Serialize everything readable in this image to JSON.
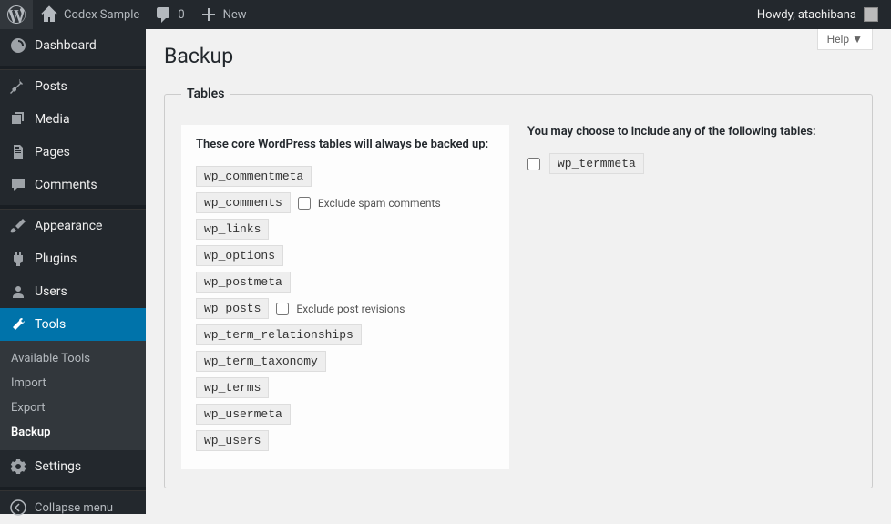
{
  "adminbar": {
    "site_name": "Codex Sample",
    "comments_count": "0",
    "new_label": "New",
    "howdy": "Howdy, atachibana"
  },
  "sidebar": {
    "dashboard": "Dashboard",
    "posts": "Posts",
    "media": "Media",
    "pages": "Pages",
    "comments": "Comments",
    "appearance": "Appearance",
    "plugins": "Plugins",
    "users": "Users",
    "tools": "Tools",
    "settings": "Settings",
    "collapse": "Collapse menu",
    "submenu": {
      "available": "Available Tools",
      "import": "Import",
      "export": "Export",
      "backup": "Backup"
    }
  },
  "page": {
    "help": "Help ▼",
    "title": "Backup",
    "fieldset_legend": "Tables",
    "core_heading": "These core WordPress tables will always be backed up:",
    "opt_heading": "You may choose to include any of the following tables:",
    "exclude_spam": "Exclude spam comments",
    "exclude_revisions": "Exclude post revisions",
    "core_tables": [
      "wp_commentmeta",
      "wp_comments",
      "wp_links",
      "wp_options",
      "wp_postmeta",
      "wp_posts",
      "wp_term_relationships",
      "wp_term_taxonomy",
      "wp_terms",
      "wp_usermeta",
      "wp_users"
    ],
    "optional_tables": [
      "wp_termmeta"
    ]
  }
}
